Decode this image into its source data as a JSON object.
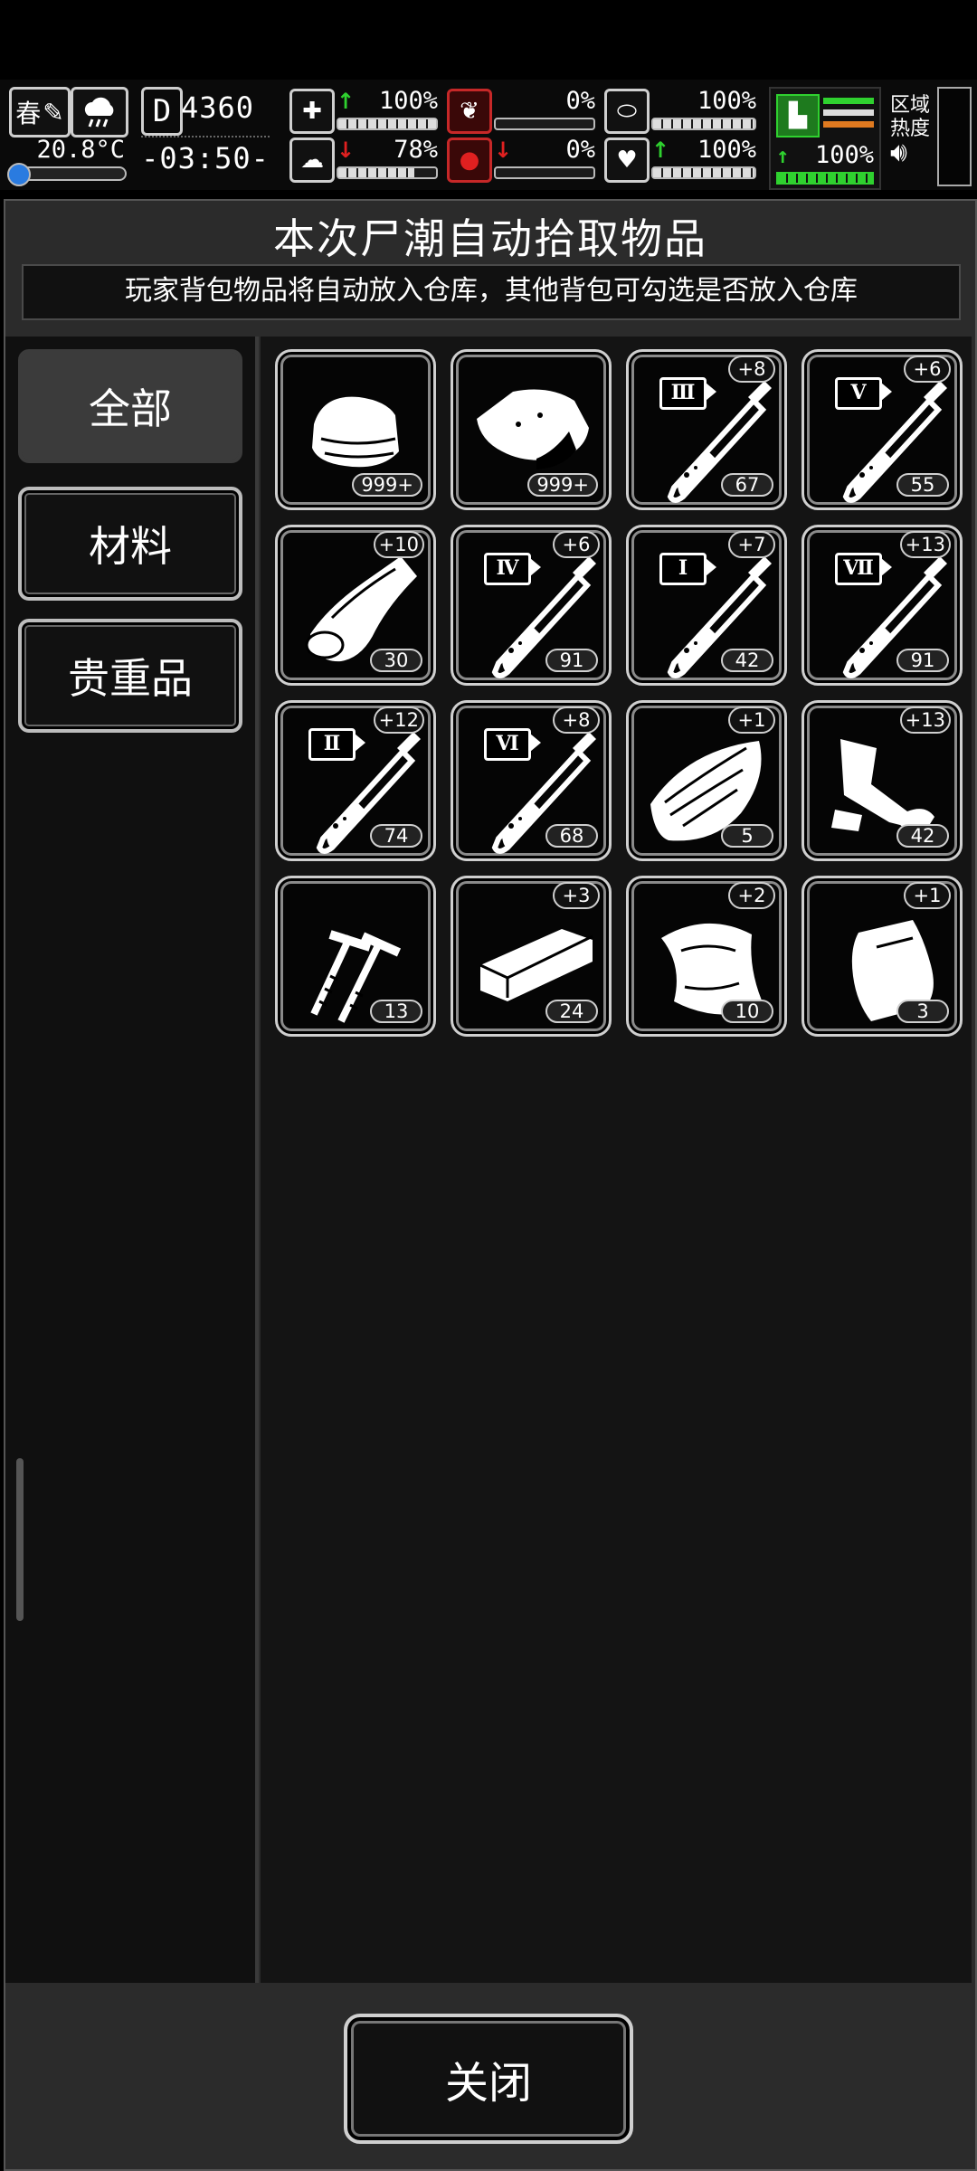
{
  "status": {
    "season": "春",
    "temperature": "20.8°C",
    "day_label": "D",
    "score": "4360",
    "clock": "-03:50-",
    "stats": [
      {
        "name": "health",
        "pct": "100%",
        "trend": "up"
      },
      {
        "name": "hunger",
        "pct": "0%",
        "trend": "none"
      },
      {
        "name": "pill",
        "pct": "100%",
        "trend": "none"
      },
      {
        "name": "mind",
        "pct": "78%",
        "trend": "down"
      },
      {
        "name": "blood",
        "pct": "0%",
        "trend": "down"
      },
      {
        "name": "heart",
        "pct": "100%",
        "trend": "up"
      }
    ],
    "stamina_pct": "100%",
    "region_label_1": "区域",
    "region_label_2": "热度",
    "colors": {
      "up": "#2fd12f",
      "down": "#e02020",
      "stamina": "#2fd12f",
      "stripe_orange": "#e07a20"
    }
  },
  "dialog": {
    "title": "本次尸潮自动拾取物品",
    "subtitle": "玩家背包物品将自动放入仓库，其他背包可勾选是否放入仓库",
    "tabs": [
      "全部",
      "材料",
      "贵重品"
    ],
    "close_label": "关闭"
  },
  "items": [
    {
      "icon": "cloth-icon",
      "plus": "",
      "count": "999+",
      "tier": ""
    },
    {
      "icon": "meat-icon",
      "plus": "",
      "count": "999+",
      "tier": ""
    },
    {
      "icon": "test-tube-icon",
      "plus": "+8",
      "count": "67",
      "tier": "Ⅲ"
    },
    {
      "icon": "test-tube-icon",
      "plus": "+6",
      "count": "55",
      "tier": "Ⅴ"
    },
    {
      "icon": "bandage-icon",
      "plus": "+10",
      "count": "30",
      "tier": ""
    },
    {
      "icon": "test-tube-icon",
      "plus": "+6",
      "count": "91",
      "tier": "Ⅳ"
    },
    {
      "icon": "test-tube-icon",
      "plus": "+7",
      "count": "42",
      "tier": "Ⅰ"
    },
    {
      "icon": "test-tube-icon",
      "plus": "+13",
      "count": "91",
      "tier": "Ⅶ"
    },
    {
      "icon": "test-tube-icon",
      "plus": "+12",
      "count": "74",
      "tier": "Ⅱ"
    },
    {
      "icon": "test-tube-icon",
      "plus": "+8",
      "count": "68",
      "tier": "Ⅵ"
    },
    {
      "icon": "wood-icon",
      "plus": "+1",
      "count": "5",
      "tier": ""
    },
    {
      "icon": "scrap-icon",
      "plus": "+13",
      "count": "42",
      "tier": ""
    },
    {
      "icon": "nails-icon",
      "plus": "",
      "count": "13",
      "tier": ""
    },
    {
      "icon": "plank-icon",
      "plus": "+3",
      "count": "24",
      "tier": ""
    },
    {
      "icon": "plastic-sheet-icon",
      "plus": "+2",
      "count": "10",
      "tier": ""
    },
    {
      "icon": "bag-icon",
      "plus": "+1",
      "count": "3",
      "tier": ""
    }
  ]
}
